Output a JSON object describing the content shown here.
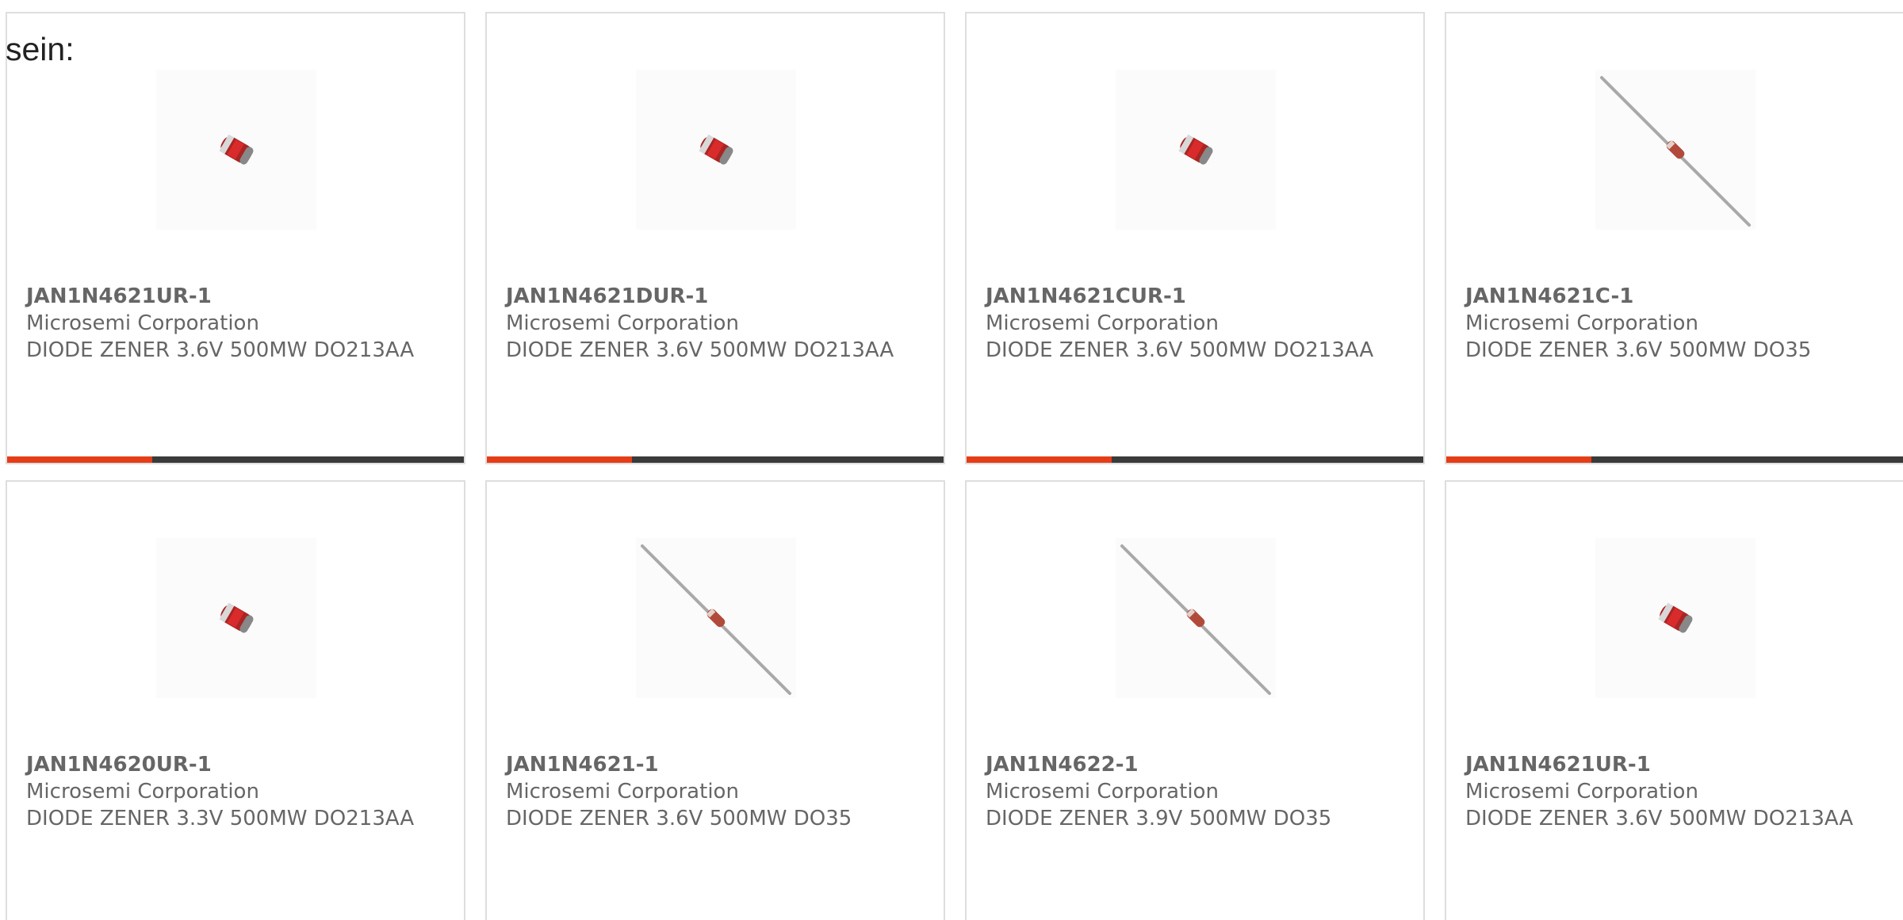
{
  "intro": {
    "text": "sein:"
  },
  "products": [
    {
      "part_number": "JAN1N4621UR-1",
      "manufacturer": "Microsemi Corporation",
      "description": "DIODE ZENER 3.6V 500MW DO213AA",
      "image_icon": "smd-diode-icon"
    },
    {
      "part_number": "JAN1N4621DUR-1",
      "manufacturer": "Microsemi Corporation",
      "description": "DIODE ZENER 3.6V 500MW DO213AA",
      "image_icon": "smd-diode-icon"
    },
    {
      "part_number": "JAN1N4621CUR-1",
      "manufacturer": "Microsemi Corporation",
      "description": "DIODE ZENER 3.6V 500MW DO213AA",
      "image_icon": "smd-diode-icon"
    },
    {
      "part_number": "JAN1N4621C-1",
      "manufacturer": "Microsemi Corporation",
      "description": "DIODE ZENER 3.6V 500MW DO35",
      "image_icon": "axial-diode-icon"
    },
    {
      "part_number": "JAN1N4620UR-1",
      "manufacturer": "Microsemi Corporation",
      "description": "DIODE ZENER 3.3V 500MW DO213AA",
      "image_icon": "smd-diode-icon"
    },
    {
      "part_number": "JAN1N4621-1",
      "manufacturer": "Microsemi Corporation",
      "description": "DIODE ZENER 3.6V 500MW DO35",
      "image_icon": "axial-diode-icon"
    },
    {
      "part_number": "JAN1N4622-1",
      "manufacturer": "Microsemi Corporation",
      "description": "DIODE ZENER 3.9V 500MW DO35",
      "image_icon": "axial-diode-icon"
    },
    {
      "part_number": "JAN1N4621UR-1",
      "manufacturer": "Microsemi Corporation",
      "description": "DIODE ZENER 3.6V 500MW DO213AA",
      "image_icon": "smd-diode-icon"
    }
  ],
  "colors": {
    "accent": "#e53d18",
    "bar": "#3a3a3a",
    "text": "#666666",
    "border": "#dedede"
  }
}
